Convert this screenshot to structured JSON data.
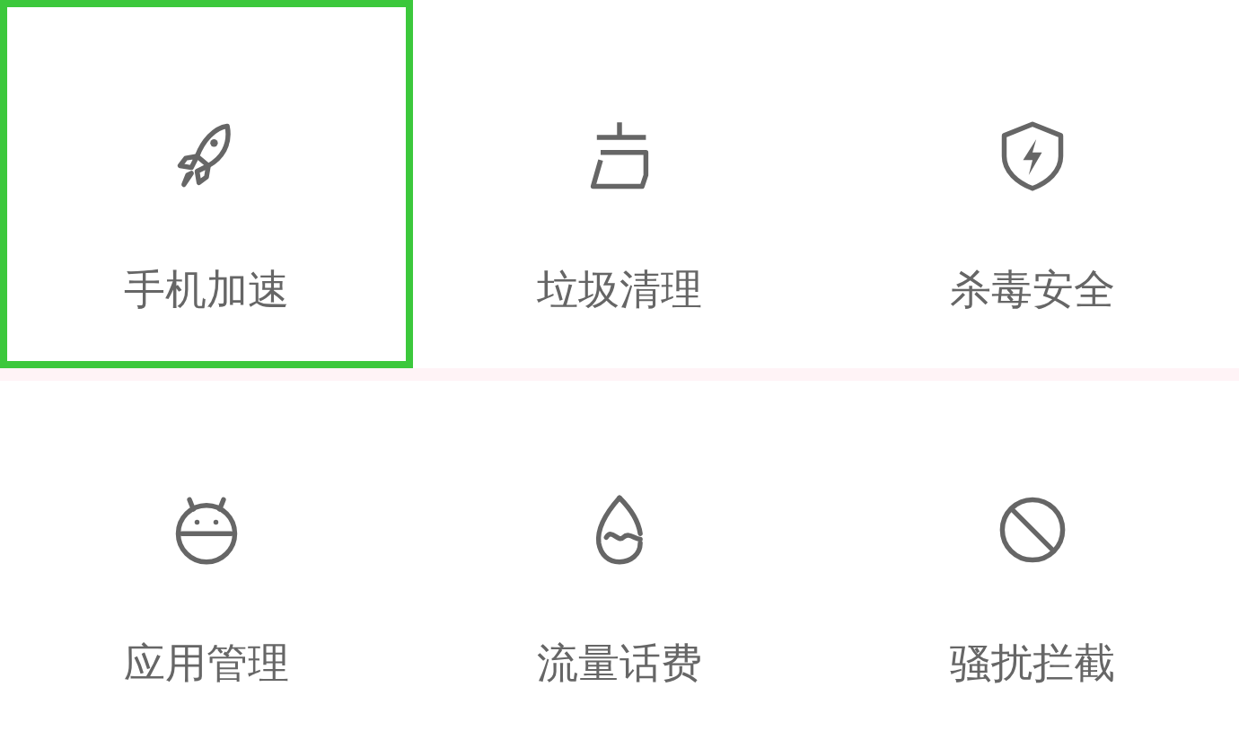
{
  "rows": [
    {
      "items": [
        {
          "kind": "rocket",
          "label": "手机加速",
          "selected": true
        },
        {
          "kind": "broom",
          "label": "垃圾清理",
          "selected": false
        },
        {
          "kind": "shield",
          "label": "杀毒安全",
          "selected": false
        }
      ]
    },
    {
      "items": [
        {
          "kind": "android",
          "label": "应用管理",
          "selected": false
        },
        {
          "kind": "drop",
          "label": "流量话费",
          "selected": false
        },
        {
          "kind": "block",
          "label": "骚扰拦截",
          "selected": false
        }
      ]
    }
  ]
}
